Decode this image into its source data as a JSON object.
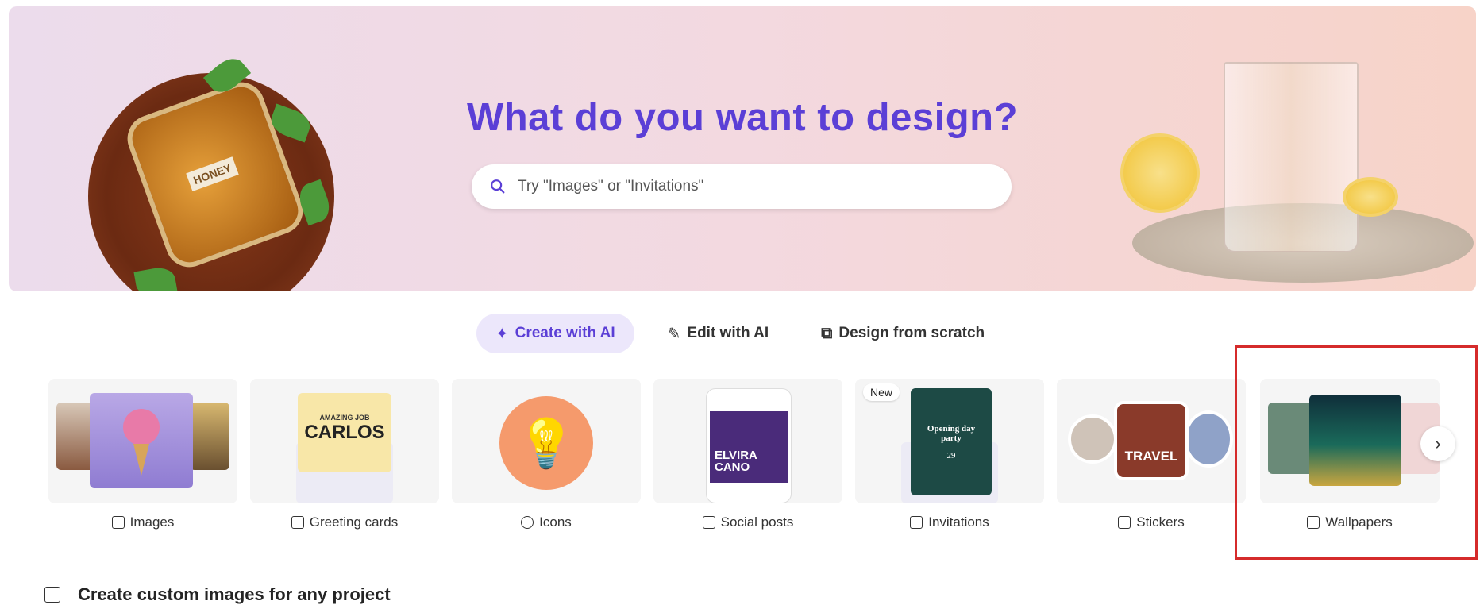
{
  "hero": {
    "title": "What do you want to design?",
    "search_placeholder": "Try \"Images\" or \"Invitations\"",
    "honey_label": "HONEY"
  },
  "modes": [
    {
      "label": "Create with AI",
      "icon": "sparkle-icon",
      "active": true
    },
    {
      "label": "Edit with AI",
      "icon": "magic-pen-icon",
      "active": false
    },
    {
      "label": "Design from scratch",
      "icon": "brush-shape-icon",
      "active": false
    }
  ],
  "categories": [
    {
      "label": "Images",
      "icon": "image-sparkle-icon"
    },
    {
      "label": "Greeting cards",
      "icon": "mail-icon",
      "thumb_text": [
        "AMAZING JOB",
        "CARLOS"
      ]
    },
    {
      "label": "Icons",
      "icon": "icons-icon"
    },
    {
      "label": "Social posts",
      "icon": "social-post-icon",
      "thumb_text": [
        "ELVIRA",
        "CANO"
      ]
    },
    {
      "label": "Invitations",
      "icon": "calendar-icon",
      "badge": "New",
      "thumb_text": [
        "Opening day party",
        "29"
      ]
    },
    {
      "label": "Stickers",
      "icon": "sticker-icon",
      "thumb_text": [
        "TRAVEL"
      ]
    },
    {
      "label": "Wallpapers",
      "icon": "wallpaper-icon"
    }
  ],
  "next_icon": "chevron-right-icon",
  "section": {
    "title": "Create custom images for any project",
    "icon": "image-sparkle-icon"
  },
  "colors": {
    "accent": "#5b3fd6",
    "active_pill": "#ece7fb",
    "highlight_box": "#d52b2b"
  }
}
